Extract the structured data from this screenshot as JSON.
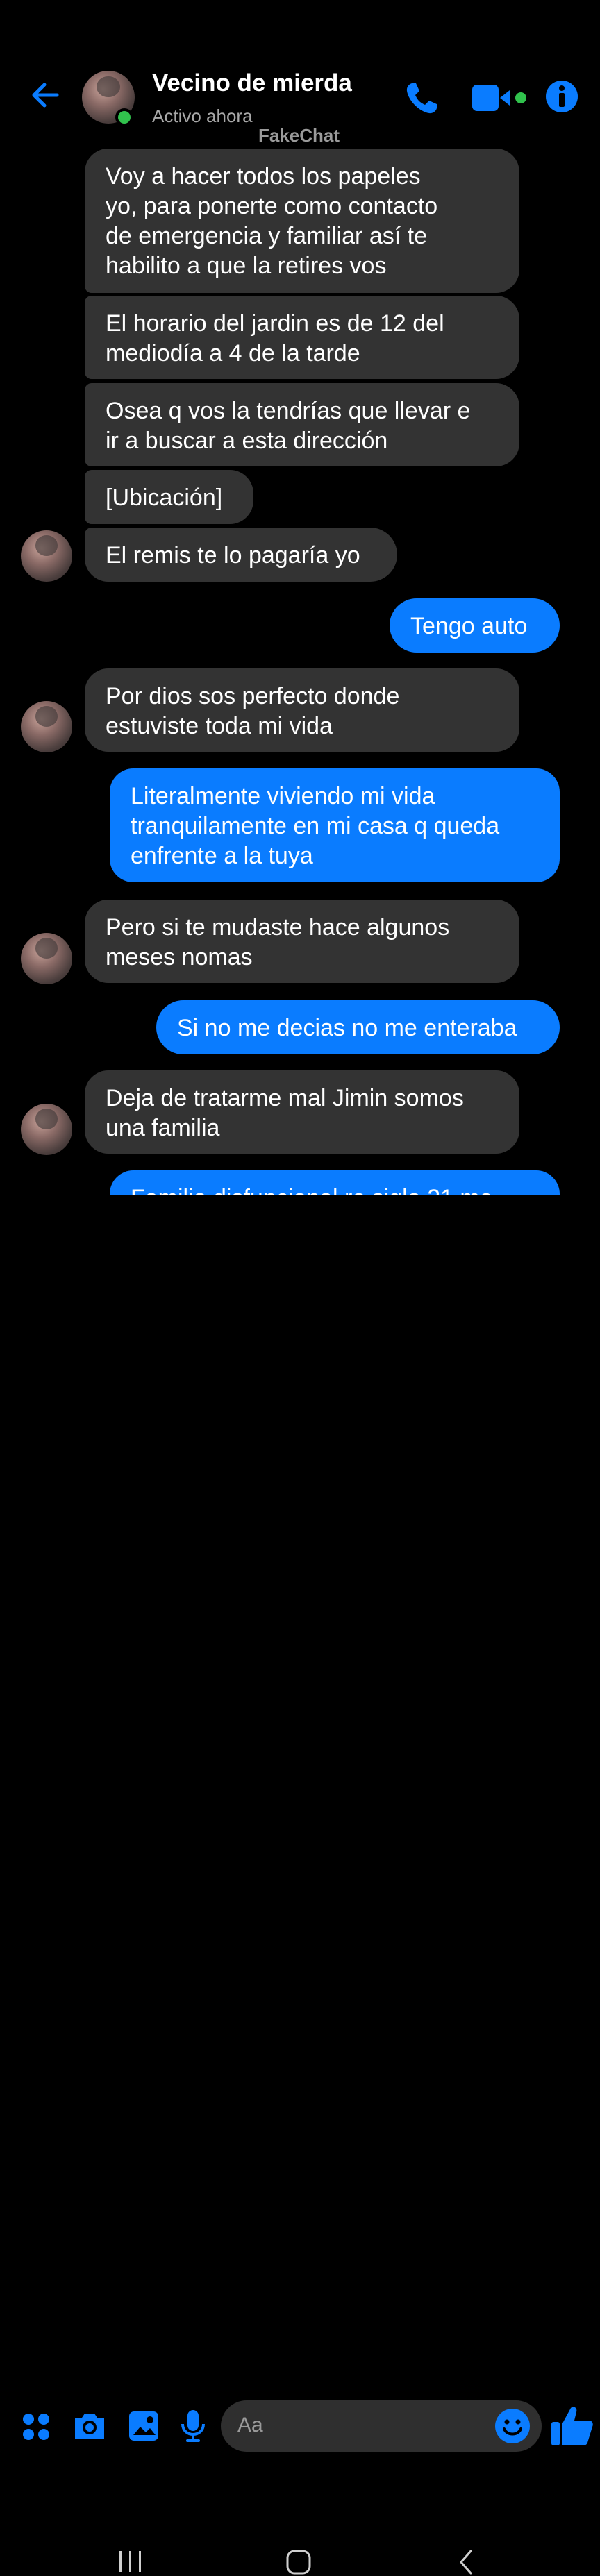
{
  "header": {
    "contact_name": "Vecino de mierda",
    "status": "Activo ahora",
    "watermark": "FakeChat"
  },
  "messages": [
    {
      "side": "incoming",
      "lines": [
        "Voy a hacer todos los papeles",
        "yo, para ponerte como contacto",
        "de emergencia y familiar así te",
        "habilito a que la retires vos"
      ]
    },
    {
      "side": "incoming",
      "lines": [
        "El horario del jardin es de 12 del",
        "mediodía a 4 de la tarde"
      ]
    },
    {
      "side": "incoming",
      "lines": [
        "Osea q vos la tendrías que llevar e",
        "ir a buscar a esta dirección"
      ]
    },
    {
      "side": "incoming",
      "lines": [
        "[Ubicación]"
      ]
    },
    {
      "side": "incoming",
      "lines": [
        "El remis te lo pagaría yo"
      ]
    },
    {
      "side": "outgoing",
      "lines": [
        "Tengo auto"
      ]
    },
    {
      "side": "incoming",
      "lines": [
        "Por dios sos perfecto donde",
        "estuviste toda mi vida"
      ]
    },
    {
      "side": "outgoing",
      "lines": [
        "Literalmente viviendo mi vida",
        "tranquilamente en mi casa q queda",
        "enfrente a la tuya"
      ]
    },
    {
      "side": "incoming",
      "lines": [
        "Pero si te mudaste hace algunos",
        "meses nomas"
      ]
    },
    {
      "side": "outgoing",
      "lines": [
        "Si no me decias no me enteraba"
      ]
    },
    {
      "side": "incoming",
      "lines": [
        "Deja de tratarme mal Jimin somos",
        "una familia"
      ]
    },
    {
      "side": "outgoing",
      "lines": [
        "Familia disfuncional re siglo 21 me"
      ]
    }
  ],
  "composer": {
    "placeholder": "Aa"
  },
  "colors": {
    "accent": "#0a7cff",
    "incoming_bubble": "#333333",
    "background": "#000000",
    "online": "#31c24d"
  },
  "icons": [
    "back-arrow-icon",
    "phone-icon",
    "video-camera-icon",
    "info-icon",
    "apps-grid-icon",
    "camera-icon",
    "gallery-icon",
    "microphone-icon",
    "emoji-icon",
    "thumbs-up-icon",
    "recent-apps-icon",
    "home-icon",
    "back-nav-icon"
  ]
}
